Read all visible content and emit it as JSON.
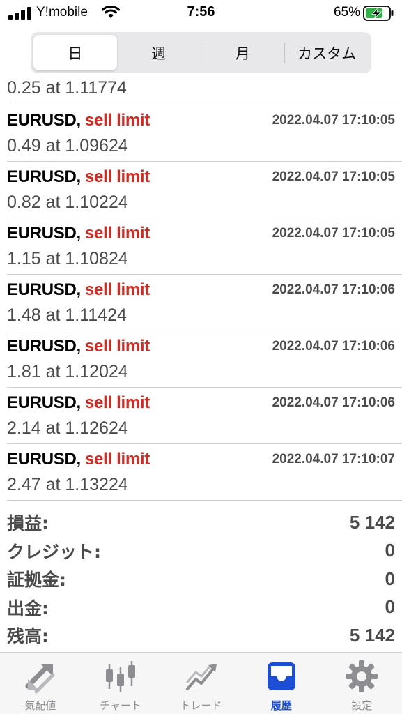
{
  "status": {
    "carrier": "Y!mobile",
    "time": "7:56",
    "battery": "65%"
  },
  "segmented": {
    "items": [
      "日",
      "週",
      "月",
      "カスタム"
    ],
    "selected": "日"
  },
  "orders": {
    "partial_first": "0.25 at 1.11774",
    "items": [
      {
        "symbol": "EURUSD,",
        "type": "sell limit",
        "time": "2022.04.07 17:10:05",
        "detail": "0.49 at 1.09624"
      },
      {
        "symbol": "EURUSD,",
        "type": "sell limit",
        "time": "2022.04.07 17:10:05",
        "detail": "0.82 at 1.10224"
      },
      {
        "symbol": "EURUSD,",
        "type": "sell limit",
        "time": "2022.04.07 17:10:05",
        "detail": "1.15 at 1.10824"
      },
      {
        "symbol": "EURUSD,",
        "type": "sell limit",
        "time": "2022.04.07 17:10:06",
        "detail": "1.48 at 1.11424"
      },
      {
        "symbol": "EURUSD,",
        "type": "sell limit",
        "time": "2022.04.07 17:10:06",
        "detail": "1.81 at 1.12024"
      },
      {
        "symbol": "EURUSD,",
        "type": "sell limit",
        "time": "2022.04.07 17:10:06",
        "detail": "2.14 at 1.12624"
      },
      {
        "symbol": "EURUSD,",
        "type": "sell limit",
        "time": "2022.04.07 17:10:07",
        "detail": "2.47 at 1.13224"
      }
    ]
  },
  "summary": {
    "profit_label": "損益:",
    "profit_value": "5 142",
    "credit_label": "クレジット:",
    "credit_value": "0",
    "deposit_label": "証拠金:",
    "deposit_value": "0",
    "withdrawal_label": "出金:",
    "withdrawal_value": "0",
    "balance_label": "残高:",
    "balance_value": "5 142"
  },
  "tabs": {
    "quotes": "気配値",
    "chart": "チャート",
    "trade": "トレード",
    "history": "履歴",
    "settings": "設定",
    "active": "history"
  },
  "colors": {
    "sell": "#d8281f",
    "accent": "#1d4fd6",
    "battery": "#2fb344"
  }
}
